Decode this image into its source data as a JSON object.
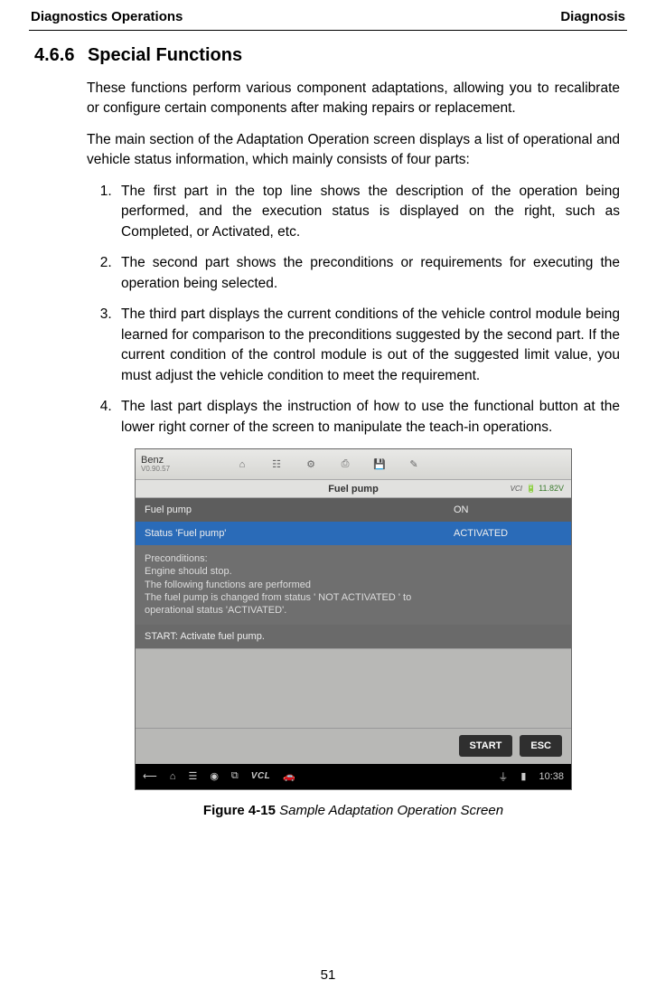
{
  "header": {
    "left": "Diagnostics Operations",
    "right": "Diagnosis"
  },
  "section": {
    "number": "4.6.6",
    "title": "Special Functions"
  },
  "paragraphs": {
    "p1": "These functions perform various component adaptations, allowing you to recalibrate or configure certain components after making repairs or replacement.",
    "p2": "The main section of the Adaptation Operation screen displays a list of operational and vehicle status information, which mainly consists of four parts:"
  },
  "parts": [
    "The first part in the top line shows the description of the operation being performed, and the execution status is displayed on the right, such as Completed, or Activated, etc.",
    "The second part shows the preconditions or requirements for executing the operation being selected.",
    "The third part displays the current conditions of the vehicle control module being learned for comparison to the preconditions suggested by the second part. If the current condition of the control module is out of the suggested limit value, you must adjust the vehicle condition to meet the requirement.",
    "The last part displays the instruction of how to use the functional button at the lower right corner of the screen to manipulate the teach-in operations."
  ],
  "screenshot": {
    "brand": {
      "name": "Benz",
      "version": "V0.90.57"
    },
    "title": "Fuel pump",
    "vci_label": "VCI",
    "battery": "11.82V",
    "rows": {
      "r1_label": "Fuel pump",
      "r1_value": "ON",
      "r2_label": "Status 'Fuel pump'",
      "r2_value": "ACTIVATED",
      "preconditions": "Preconditions:\nEngine should stop.\nThe following functions are performed\nThe fuel pump is changed from status ' NOT ACTIVATED ' to operational status 'ACTIVATED'.",
      "instr": "START: Activate fuel pump."
    },
    "buttons": {
      "start": "START",
      "esc": "ESC"
    },
    "status": {
      "vcl": "VCL",
      "clock": "10:38"
    }
  },
  "figure": {
    "label": "Figure 4-15",
    "caption": "Sample Adaptation Operation Screen"
  },
  "page_number": "51"
}
